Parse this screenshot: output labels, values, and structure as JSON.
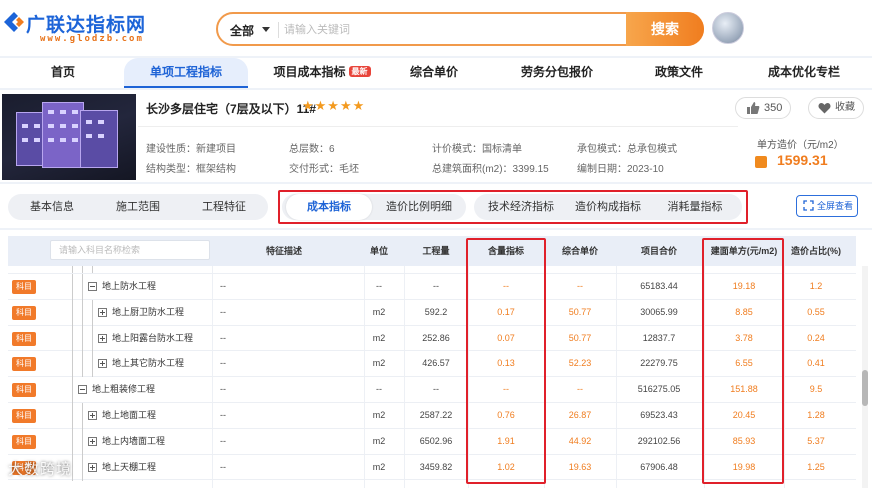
{
  "site": {
    "name": "广联达指标网",
    "url": "www.glodzb.com"
  },
  "search": {
    "category": "全部",
    "placeholder": "请输入关键词",
    "button": "搜索"
  },
  "nav": [
    {
      "label": "首页"
    },
    {
      "label": "单项工程指标",
      "active": true
    },
    {
      "label": "项目成本指标",
      "badge": "最新"
    },
    {
      "label": "综合单价"
    },
    {
      "label": "劳务分包报价"
    },
    {
      "label": "政策文件"
    },
    {
      "label": "成本优化专栏"
    }
  ],
  "project": {
    "title": "长沙多层住宅（7层及以下）11#",
    "stars": "★★★★★",
    "likes": "350",
    "favorite": "收藏",
    "meta": {
      "build_nature": "建设性质：新建项目",
      "structure": "结构类型：框架结构",
      "floors": "总层数：6",
      "delivery": "交付形式：毛坯",
      "pricing_mode": "计价模式：国标清单",
      "area": "总建筑面积(m2)：3399.15",
      "contract_mode": "承包模式：总承包模式",
      "compile_time": "编制日期：2023-10"
    },
    "price_label": "单方造价（元/m2）",
    "price_value": "1599.31"
  },
  "tabs_left": [
    "基本信息",
    "施工范围",
    "工程特征"
  ],
  "tabs_mid": [
    "成本指标",
    "造价比例明细"
  ],
  "tabs_right": [
    "技术经济指标",
    "造价构成指标",
    "消耗量指标"
  ],
  "fullscreen": "全屏查看",
  "table": {
    "filter_placeholder": "请输入科目名称检索",
    "headers": [
      "特征描述",
      "单位",
      "工程量",
      "含量指标",
      "综合单价",
      "项目合价",
      "建面单方(元/m2)",
      "造价占比(%)"
    ],
    "rows": [
      {
        "tag": "",
        "name": "",
        "feature": "",
        "unit": "",
        "qty": "",
        "content": "",
        "unit_price": "",
        "total": "",
        "per_area": "",
        "ratio": "",
        "level": 2,
        "kind": "partial"
      },
      {
        "tag": "科目",
        "name": "地上防水工程",
        "feature": "--",
        "unit": "--",
        "qty": "--",
        "content": "--",
        "unit_price": "--",
        "total": "65183.44",
        "per_area": "19.18",
        "ratio": "1.2",
        "level": 1,
        "kind": "minus"
      },
      {
        "tag": "科目",
        "name": "地上厨卫防水工程",
        "feature": "--",
        "unit": "m2",
        "qty": "592.2",
        "content": "0.17",
        "unit_price": "50.77",
        "total": "30065.99",
        "per_area": "8.85",
        "ratio": "0.55",
        "level": 2,
        "kind": "plus"
      },
      {
        "tag": "科目",
        "name": "地上阳露台防水工程",
        "feature": "--",
        "unit": "m2",
        "qty": "252.86",
        "content": "0.07",
        "unit_price": "50.77",
        "total": "12837.7",
        "per_area": "3.78",
        "ratio": "0.24",
        "level": 2,
        "kind": "plus"
      },
      {
        "tag": "科目",
        "name": "地上其它防水工程",
        "feature": "--",
        "unit": "m2",
        "qty": "426.57",
        "content": "0.13",
        "unit_price": "52.23",
        "total": "22279.75",
        "per_area": "6.55",
        "ratio": "0.41",
        "level": 2,
        "kind": "plus"
      },
      {
        "tag": "科目",
        "name": "地上粗装修工程",
        "feature": "--",
        "unit": "--",
        "qty": "--",
        "content": "--",
        "unit_price": "--",
        "total": "516275.05",
        "per_area": "151.88",
        "ratio": "9.5",
        "level": 0,
        "kind": "minus"
      },
      {
        "tag": "科目",
        "name": "地上地面工程",
        "feature": "--",
        "unit": "m2",
        "qty": "2587.22",
        "content": "0.76",
        "unit_price": "26.87",
        "total": "69523.43",
        "per_area": "20.45",
        "ratio": "1.28",
        "level": 1,
        "kind": "plus"
      },
      {
        "tag": "科目",
        "name": "地上内墙面工程",
        "feature": "--",
        "unit": "m2",
        "qty": "6502.96",
        "content": "1.91",
        "unit_price": "44.92",
        "total": "292102.56",
        "per_area": "85.93",
        "ratio": "5.37",
        "level": 1,
        "kind": "plus"
      },
      {
        "tag": "科目",
        "name": "地上天棚工程",
        "feature": "--",
        "unit": "m2",
        "qty": "3459.82",
        "content": "1.02",
        "unit_price": "19.63",
        "total": "67906.48",
        "per_area": "19.98",
        "ratio": "1.25",
        "level": 1,
        "kind": "plus"
      }
    ]
  },
  "watermark": "大数跨境",
  "colors": {
    "accent": "#1e63d6",
    "orange": "#f07d1f",
    "highlight": "#e0202a"
  }
}
